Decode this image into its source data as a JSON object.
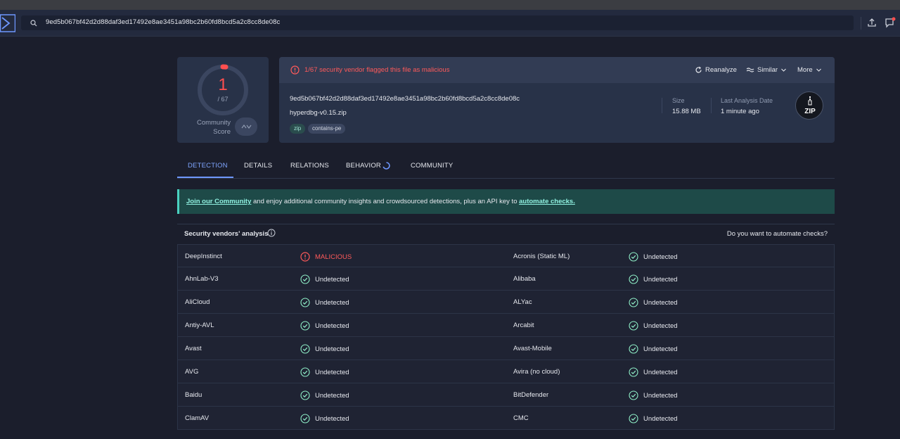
{
  "header": {
    "search_value": "9ed5b067bf42d2d88daf3ed17492e8ae3451a98bc2b60fd8bcd5a2c8cc8de08c",
    "icons": [
      "logo-icon",
      "search-icon",
      "upload-icon",
      "chat-icon"
    ]
  },
  "score": {
    "detections": "1",
    "total": "/ 67",
    "community_label": "Community Score"
  },
  "summary": {
    "alert": "1/67 security vendor flagged this file as malicious",
    "actions": {
      "reanalyze": "Reanalyze",
      "similar": "Similar",
      "more": "More"
    },
    "hash": "9ed5b067bf42d2d88daf3ed17492e8ae3451a98bc2b60fd8bcd5a2c8cc8de08c",
    "filename": "hyperdbg-v0.15.zip",
    "tags": [
      "zip",
      "contains-pe"
    ],
    "size_label": "Size",
    "size_value": "15.88 MB",
    "date_label": "Last Analysis Date",
    "date_value": "1 minute ago",
    "file_type": "ZIP"
  },
  "tabs": [
    "DETECTION",
    "DETAILS",
    "RELATIONS",
    "BEHAVIOR",
    "COMMUNITY"
  ],
  "banner": {
    "link1": "Join our Community",
    "middle": " and enjoy additional community insights and crowdsourced detections, plus an API key to ",
    "link2": "automate checks."
  },
  "vendors_header": {
    "title": "Security vendors' analysis",
    "right": "Do you want to automate checks?"
  },
  "vendors": [
    {
      "left": "DeepInstinct",
      "left_result": "MALICIOUS",
      "left_malicious": true,
      "right": "Acronis (Static ML)",
      "right_result": "Undetected"
    },
    {
      "left": "AhnLab-V3",
      "left_result": "Undetected",
      "left_malicious": false,
      "right": "Alibaba",
      "right_result": "Undetected"
    },
    {
      "left": "AliCloud",
      "left_result": "Undetected",
      "left_malicious": false,
      "right": "ALYac",
      "right_result": "Undetected"
    },
    {
      "left": "Antiy-AVL",
      "left_result": "Undetected",
      "left_malicious": false,
      "right": "Arcabit",
      "right_result": "Undetected"
    },
    {
      "left": "Avast",
      "left_result": "Undetected",
      "left_malicious": false,
      "right": "Avast-Mobile",
      "right_result": "Undetected"
    },
    {
      "left": "AVG",
      "left_result": "Undetected",
      "left_malicious": false,
      "right": "Avira (no cloud)",
      "right_result": "Undetected"
    },
    {
      "left": "Baidu",
      "left_result": "Undetected",
      "left_malicious": false,
      "right": "BitDefender",
      "right_result": "Undetected"
    },
    {
      "left": "ClamAV",
      "left_result": "Undetected",
      "left_malicious": false,
      "right": "CMC",
      "right_result": "Undetected"
    }
  ],
  "colors": {
    "background": "#1b1e2c",
    "card": "#283248",
    "malicious": "#ff5a5a",
    "undetected": "#8ff0c8",
    "accent": "#7fa6ff"
  }
}
